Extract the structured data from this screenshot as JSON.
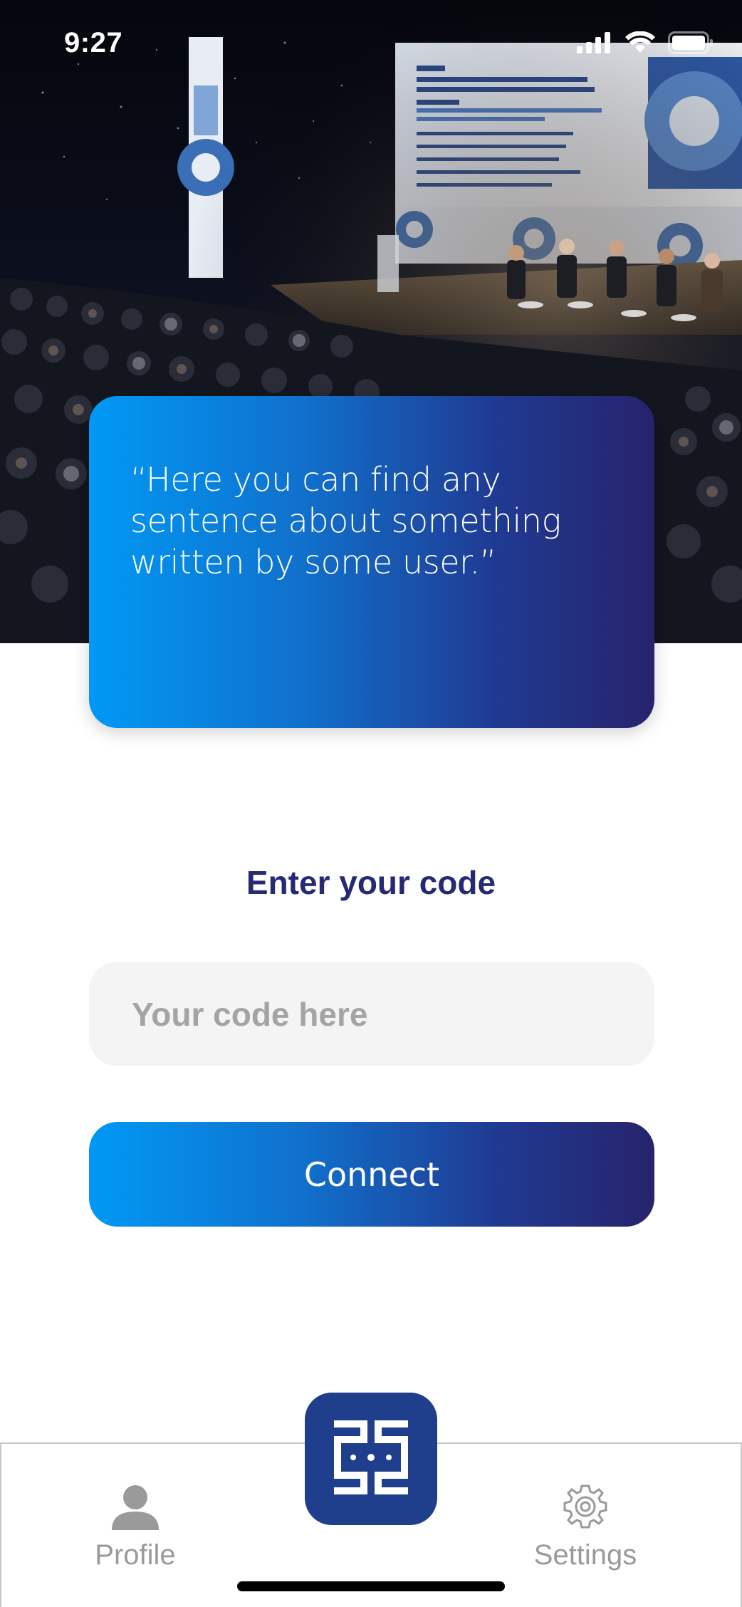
{
  "status_bar": {
    "time": "9:27",
    "icons": [
      "signal-icon",
      "wifi-icon",
      "battery-icon"
    ]
  },
  "hero": {
    "image": "conference-panel-photo",
    "quote": "“Here you can find any sentence about something written by some user.”"
  },
  "code_form": {
    "title": "Enter your code",
    "input_placeholder": "Your code here",
    "input_value": "",
    "connect_label": "Connect"
  },
  "tab_bar": {
    "items": [
      {
        "label": "Profile",
        "icon": "person-icon"
      },
      {
        "label": "Settings",
        "icon": "gear-icon"
      }
    ],
    "center_icon": "app-logo-icon"
  },
  "colors": {
    "gradient_start": "#0099f5",
    "gradient_end": "#27236c",
    "title": "#262a72",
    "input_bg": "#f4f4f4",
    "tab_label": "#9a9a9a",
    "logo_bg": "#1f3e8c"
  }
}
